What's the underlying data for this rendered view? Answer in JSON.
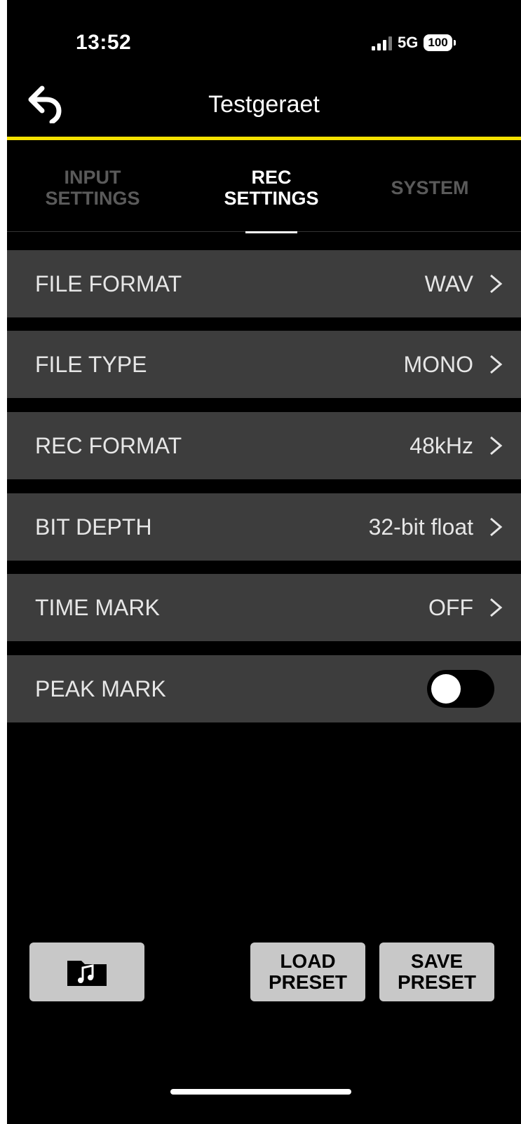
{
  "status_bar": {
    "time": "13:52",
    "network": "5G",
    "battery": "100"
  },
  "header": {
    "title": "Testgeraet"
  },
  "tabs": [
    {
      "line1": "INPUT",
      "line2": "SETTINGS",
      "active": false
    },
    {
      "line1": "REC",
      "line2": "SETTINGS",
      "active": true
    },
    {
      "line1": "SYSTEM",
      "line2": "",
      "active": false
    }
  ],
  "settings": [
    {
      "label": "FILE FORMAT",
      "value": "WAV"
    },
    {
      "label": "FILE TYPE",
      "value": "MONO"
    },
    {
      "label": "REC FORMAT",
      "value": "48kHz"
    },
    {
      "label": "BIT DEPTH",
      "value": "32-bit float"
    },
    {
      "label": "TIME MARK",
      "value": "OFF"
    },
    {
      "label": "PEAK MARK",
      "toggle": false
    }
  ],
  "buttons": {
    "load": {
      "line1": "LOAD",
      "line2": "PRESET"
    },
    "save": {
      "line1": "SAVE",
      "line2": "PRESET"
    }
  },
  "colors": {
    "accent": "#f5e100",
    "row_bg": "#3d3d3d",
    "button_bg": "#c8c8c8",
    "background": "#000000"
  },
  "icons": {
    "back": "back-arrow-icon",
    "folder": "music-folder-icon",
    "chevron": "chevron-right-icon"
  }
}
